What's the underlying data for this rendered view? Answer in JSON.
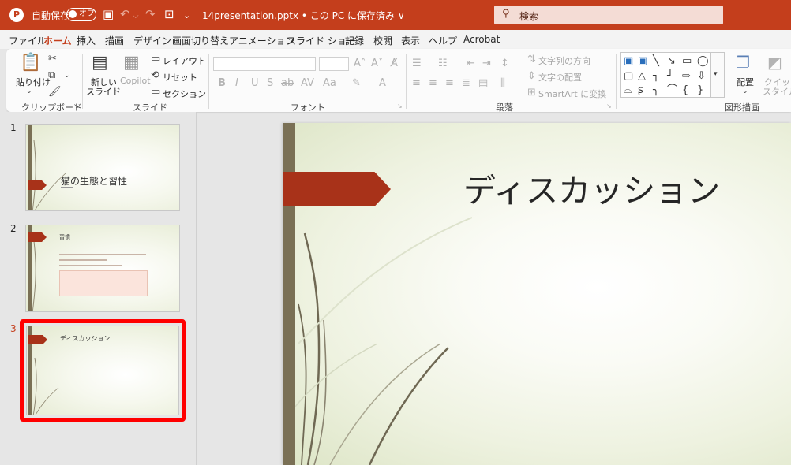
{
  "titlebar": {
    "autosave_label": "自動保存",
    "toggle_state": "オフ",
    "filename": "14presentation.pptx • この PC に保存済み ∨",
    "search_placeholder": "検索"
  },
  "menu_tabs": [
    "ファイル",
    "ホーム",
    "挿入",
    "描画",
    "デザイン",
    "画面切り替え",
    "アニメーション",
    "スライド ショー",
    "記録",
    "校閲",
    "表示",
    "ヘルプ",
    "Acrobat"
  ],
  "active_tab": "ホーム",
  "ribbon": {
    "clipboard": {
      "paste": "貼り付け",
      "group": "クリップボード"
    },
    "slides": {
      "new_slide": "新しい",
      "new_slide2": "スライド",
      "copilot": "Copilot",
      "layout": "レイアウト",
      "reset": "リセット",
      "section": "セクション",
      "group": "スライド"
    },
    "font": {
      "group": "フォント"
    },
    "paragraph": {
      "text_direction": "文字列の方向",
      "align_text": "文字の配置",
      "smartart": "SmartArt に変換",
      "group": "段落"
    },
    "drawing": {
      "arrange": "配置",
      "quick_style": "クイック",
      "quick_style2": "スタイル",
      "group": "図形描画"
    }
  },
  "slides": [
    {
      "number": "1",
      "title": "猫の生態と習性"
    },
    {
      "number": "2",
      "title": "習慣"
    },
    {
      "number": "3",
      "title": "ディスカッション"
    }
  ],
  "current_slide": {
    "number": "3",
    "title": "ディスカッション"
  },
  "colors": {
    "brand": "#c43e1c",
    "accent_arrow": "#a83219",
    "selection_frame": "#ff0000"
  }
}
